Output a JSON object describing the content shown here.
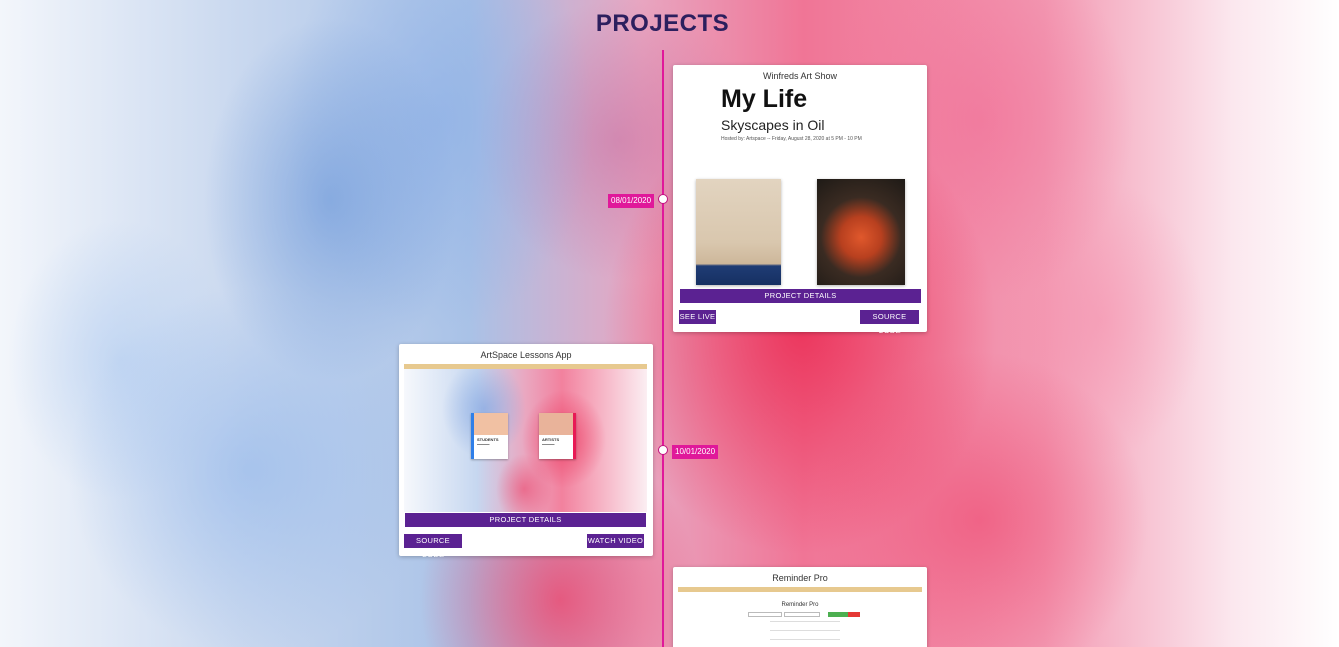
{
  "page": {
    "title": "PROJECTS"
  },
  "timeline": {
    "entries": [
      {
        "date": "08/01/2020"
      },
      {
        "date": "10/01/2020"
      }
    ]
  },
  "projects": [
    {
      "name": "Winfreds Art Show",
      "preview": {
        "heading": "My Life",
        "subheading": "Skyscapes in Oil",
        "host_line": "Hosted by: Artspace -- Friday, August 28, 2020 at 5 PM - 10 PM"
      },
      "details_label": "PROJECT DETAILS",
      "left_button": "SEE LIVE",
      "right_button": "SOURCE CODE"
    },
    {
      "name": "ArtSpace Lessons App",
      "preview": {
        "card_left": "STUDENTS",
        "card_right": "ARTISTS"
      },
      "details_label": "PROJECT DETAILS",
      "left_button": "SOURCE CODE",
      "right_button": "WATCH VIDEO"
    },
    {
      "name": "Reminder Pro",
      "preview": {
        "app_title": "Reminder Pro"
      }
    }
  ],
  "colors": {
    "accent": "#5b2292",
    "timeline": "#e0189a",
    "title": "#2c1f5e"
  }
}
